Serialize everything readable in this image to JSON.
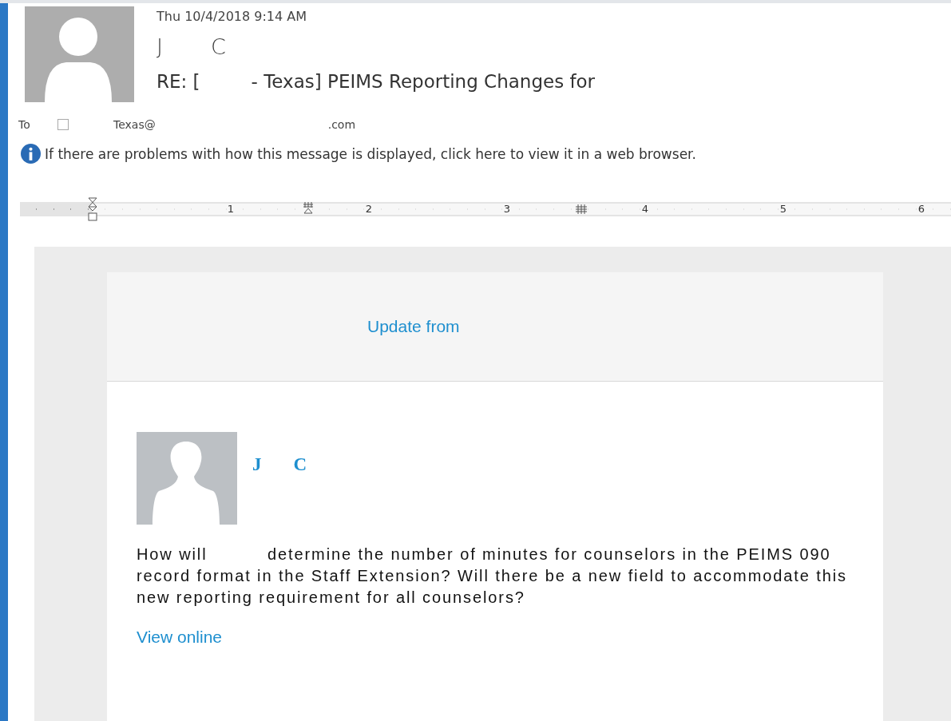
{
  "header": {
    "date": "Thu 10/4/2018 9:14 AM",
    "sender": [
      "J",
      "C"
    ],
    "subject": [
      "RE: [",
      "- Texas] PEIMS Reporting Changes for"
    ],
    "to": {
      "label": "To",
      "checked": false,
      "address": [
        "Texas@",
        ".com"
      ]
    },
    "infobar": "If there are problems with how this message is displayed, click here to view it in a web browser."
  },
  "ruler": {
    "numbers": [
      "1",
      "2",
      "3",
      "4",
      "5",
      "6"
    ]
  },
  "message": {
    "banner": "Update from",
    "author": [
      "J",
      "C"
    ],
    "body": [
      "How will",
      "determine the number of minutes for counselors in the PEIMS 090 record format in the Staff Extension? Will there be a new field to accommodate this new reporting requirement for all counselors?"
    ],
    "link": "View online"
  }
}
